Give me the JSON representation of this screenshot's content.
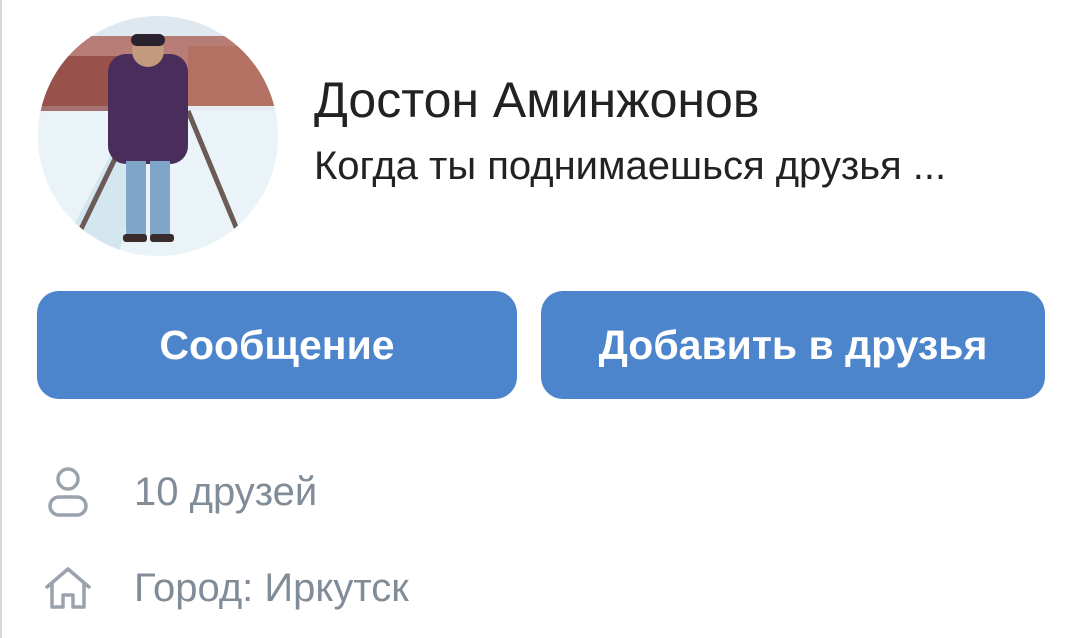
{
  "profile": {
    "name": "Достон Аминжонов",
    "status": "Когда ты поднимаешься друзья ..."
  },
  "actions": {
    "message_label": "Сообщение",
    "add_friend_label": "Добавить в друзья"
  },
  "info": {
    "friends": "10 друзей",
    "city": "Город: Иркутск"
  },
  "colors": {
    "accent": "#4c85cb",
    "secondary_text": "#818c99",
    "icon": "#99a2ad",
    "primary_text": "#222222"
  },
  "icons": {
    "friends": "person-icon",
    "city": "home-icon"
  }
}
